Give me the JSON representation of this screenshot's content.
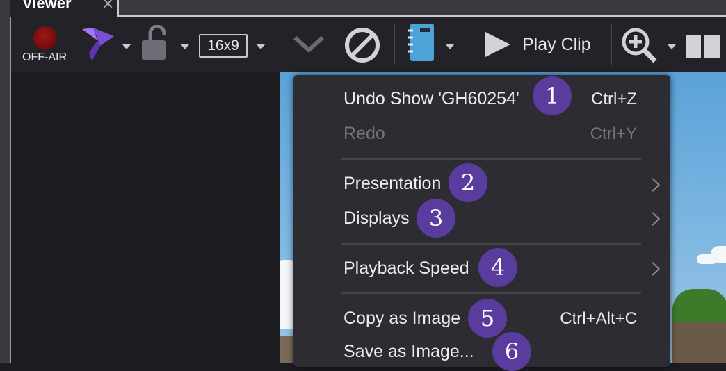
{
  "tab": {
    "title": "Viewer",
    "close": "×"
  },
  "toolbar": {
    "status_label": "OFF-AIR",
    "aspect_label": "16x9",
    "play_clip_label": "Play Clip"
  },
  "menu": {
    "items": [
      {
        "label": "Undo Show 'GH60254'",
        "shortcut": "Ctrl+Z",
        "enabled": true
      },
      {
        "label": "Redo",
        "shortcut": "Ctrl+Y",
        "enabled": false
      },
      {
        "label": "Presentation",
        "submenu": true
      },
      {
        "label": "Displays",
        "submenu": true
      },
      {
        "label": "Playback Speed",
        "submenu": true
      },
      {
        "label": "Copy as Image",
        "shortcut": "Ctrl+Alt+C"
      },
      {
        "label": "Save as Image..."
      }
    ]
  },
  "callouts": [
    "1",
    "2",
    "3",
    "4",
    "5",
    "6"
  ],
  "colors": {
    "callout": "#5a3c9e",
    "accent_purple": "#8d5fe0",
    "off_air_red": "#8a0e0e"
  }
}
